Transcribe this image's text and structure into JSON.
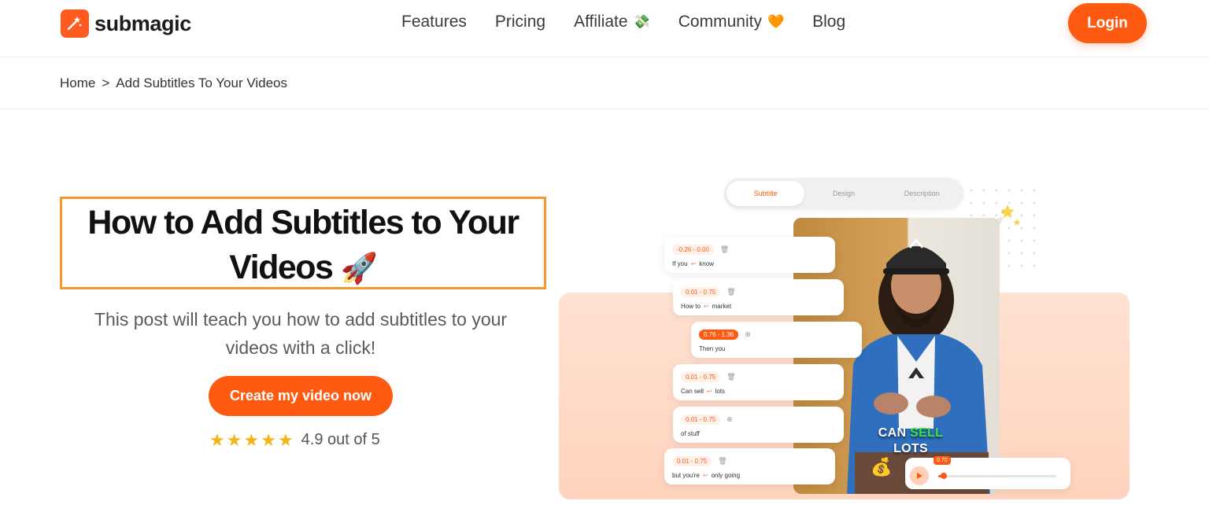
{
  "header": {
    "brand": "submagic",
    "nav": [
      {
        "label": "Features",
        "emoji": ""
      },
      {
        "label": "Pricing",
        "emoji": ""
      },
      {
        "label": "Affiliate",
        "emoji": "💸"
      },
      {
        "label": "Community",
        "emoji": "🧡"
      },
      {
        "label": "Blog",
        "emoji": ""
      }
    ],
    "login_label": "Login"
  },
  "breadcrumb": {
    "home": "Home",
    "separator": ">",
    "current": "Add Subtitles To Your Videos"
  },
  "hero": {
    "title_line1": "How to Add Subtitles to Your",
    "title_line2": "Videos",
    "title_emoji": "🚀",
    "subtitle_line1": "This post will teach you how to add subtitles to your",
    "subtitle_line2": "videos with a click!",
    "cta_label": "Create my video now",
    "rating_stars": 5,
    "rating_text": "4.9 out of 5"
  },
  "editor": {
    "tabs": [
      "Subtitle",
      "Design",
      "Description"
    ],
    "active_tab": "Subtitle",
    "cards": [
      {
        "time": "-0.26 - 0.00",
        "icon": "🗑",
        "word1": "If you",
        "word2": "know"
      },
      {
        "time": "0.01 - 0.75",
        "icon": "🗑",
        "word1": "How to",
        "word2": "market"
      },
      {
        "time": "0.76 - 1.36",
        "icon": "⊕",
        "word1": "Then you",
        "word2": ""
      },
      {
        "time": "0.01 - 0.75",
        "icon": "🗑",
        "word1": "Can sell",
        "word2": "lots"
      },
      {
        "time": "0.01 - 0.75",
        "icon": "⊕",
        "word1": "of stuff",
        "word2": ""
      },
      {
        "time": "0.01 - 0.75",
        "icon": "🗑",
        "word1": "but you're",
        "word2": "only going"
      }
    ],
    "video_caption_1": "CAN",
    "video_caption_hl": "SELL",
    "video_caption_2": "LOTS",
    "player_time": "0.70",
    "player_progress": 0.03
  },
  "colors": {
    "accent": "#ff5a12",
    "title_border": "#f4982f",
    "star": "#f6b515"
  }
}
